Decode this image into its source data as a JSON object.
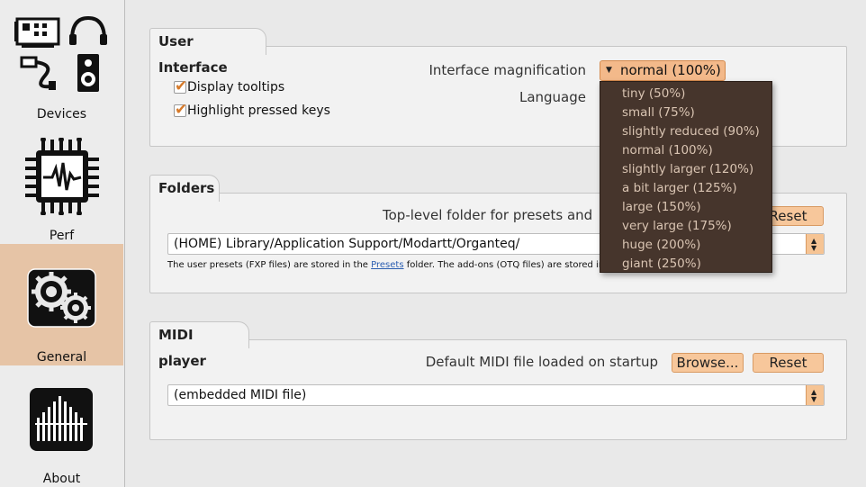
{
  "sidebar": {
    "items": [
      {
        "label": "Devices",
        "icon": "devices-icon"
      },
      {
        "label": "Perf",
        "icon": "chip-icon"
      },
      {
        "label": "General",
        "icon": "gears-icon",
        "selected": true
      },
      {
        "label": "About",
        "icon": "organ-pipes-icon"
      }
    ]
  },
  "ui_group": {
    "title": "User Interface",
    "magnification_label": "Interface magnification",
    "magnification_value": "normal (100%)",
    "language_label": "Language",
    "display_tooltips": {
      "label": "Display tooltips",
      "checked": true
    },
    "highlight_keys": {
      "label": "Highlight pressed keys",
      "checked": true
    }
  },
  "magnification_options": [
    "tiny (50%)",
    "small (75%)",
    "slightly reduced (90%)",
    "normal (100%)",
    "slightly larger (120%)",
    "a bit larger (125%)",
    "large (150%)",
    "very large (175%)",
    "huge (200%)",
    "giant (250%)"
  ],
  "folders_group": {
    "title": "Folders",
    "toplevel_label": "Top-level folder for presets and",
    "reset_label": "Reset",
    "path": "(HOME) Library/Application Support/Modartt/Organteq/",
    "note_prefix": "The user presets (FXP files) are stored in the",
    "note_link": "Presets",
    "note_suffix": "folder. The add-ons (OTQ files) are stored in"
  },
  "midi_group": {
    "title": "MIDI player",
    "default_label": "Default MIDI file loaded on startup",
    "browse_label": "Browse...",
    "reset_label": "Reset",
    "file": "(embedded MIDI file)"
  },
  "colors": {
    "accent": "#f7c79b",
    "selected_sidebar": "#e6c4a6",
    "dropdown_bg": "#46352c",
    "dropdown_text": "#d9c4b2",
    "check": "#d67a2a"
  }
}
